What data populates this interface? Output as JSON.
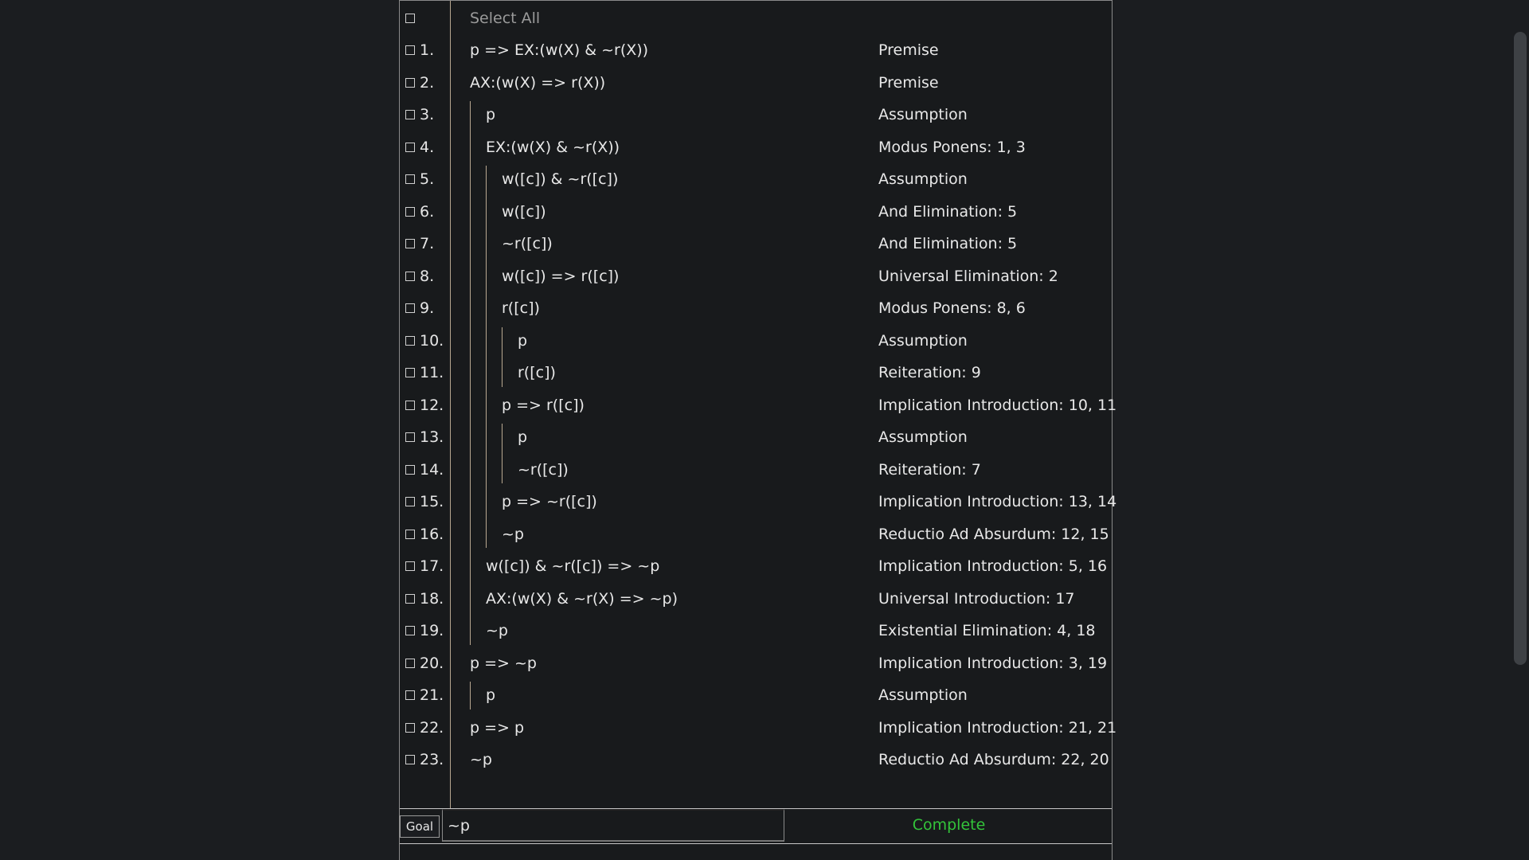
{
  "select_all_label": "Select All",
  "rows": [
    {
      "num": "1.",
      "formula": "p => EX:(w(X) & ~r(X))",
      "just": "Premise"
    },
    {
      "num": "2.",
      "formula": "AX:(w(X) => r(X))",
      "just": "Premise"
    },
    {
      "num": "3.",
      "formula": "p",
      "just": "Assumption"
    },
    {
      "num": "4.",
      "formula": "EX:(w(X) & ~r(X))",
      "just": "Modus Ponens: 1, 3"
    },
    {
      "num": "5.",
      "formula": "w([c]) & ~r([c])",
      "just": "Assumption"
    },
    {
      "num": "6.",
      "formula": "w([c])",
      "just": "And Elimination: 5"
    },
    {
      "num": "7.",
      "formula": "~r([c])",
      "just": "And Elimination: 5"
    },
    {
      "num": "8.",
      "formula": "w([c]) => r([c])",
      "just": "Universal Elimination: 2"
    },
    {
      "num": "9.",
      "formula": "r([c])",
      "just": "Modus Ponens: 8, 6"
    },
    {
      "num": "10.",
      "formula": "p",
      "just": "Assumption"
    },
    {
      "num": "11.",
      "formula": "r([c])",
      "just": "Reiteration: 9"
    },
    {
      "num": "12.",
      "formula": "p => r([c])",
      "just": "Implication Introduction: 10, 11"
    },
    {
      "num": "13.",
      "formula": "p",
      "just": "Assumption"
    },
    {
      "num": "14.",
      "formula": "~r([c])",
      "just": "Reiteration: 7"
    },
    {
      "num": "15.",
      "formula": "p => ~r([c])",
      "just": "Implication Introduction: 13, 14"
    },
    {
      "num": "16.",
      "formula": "~p",
      "just": "Reductio Ad Absurdum: 12, 15"
    },
    {
      "num": "17.",
      "formula": "w([c]) & ~r([c]) => ~p",
      "just": "Implication Introduction: 5, 16"
    },
    {
      "num": "18.",
      "formula": "AX:(w(X) & ~r(X) => ~p)",
      "just": "Universal Introduction: 17"
    },
    {
      "num": "19.",
      "formula": "~p",
      "just": "Existential Elimination: 4, 18"
    },
    {
      "num": "20.",
      "formula": "p => ~p",
      "just": "Implication Introduction: 3, 19"
    },
    {
      "num": "21.",
      "formula": "p",
      "just": "Assumption"
    },
    {
      "num": "22.",
      "formula": "p => p",
      "just": "Implication Introduction: 21, 21"
    },
    {
      "num": "23.",
      "formula": "~p",
      "just": "Reductio Ad Absurdum: 22, 20"
    }
  ],
  "goal": {
    "button_label": "Goal",
    "value": "~p",
    "status": "Complete",
    "status_color": "#33c43a"
  }
}
